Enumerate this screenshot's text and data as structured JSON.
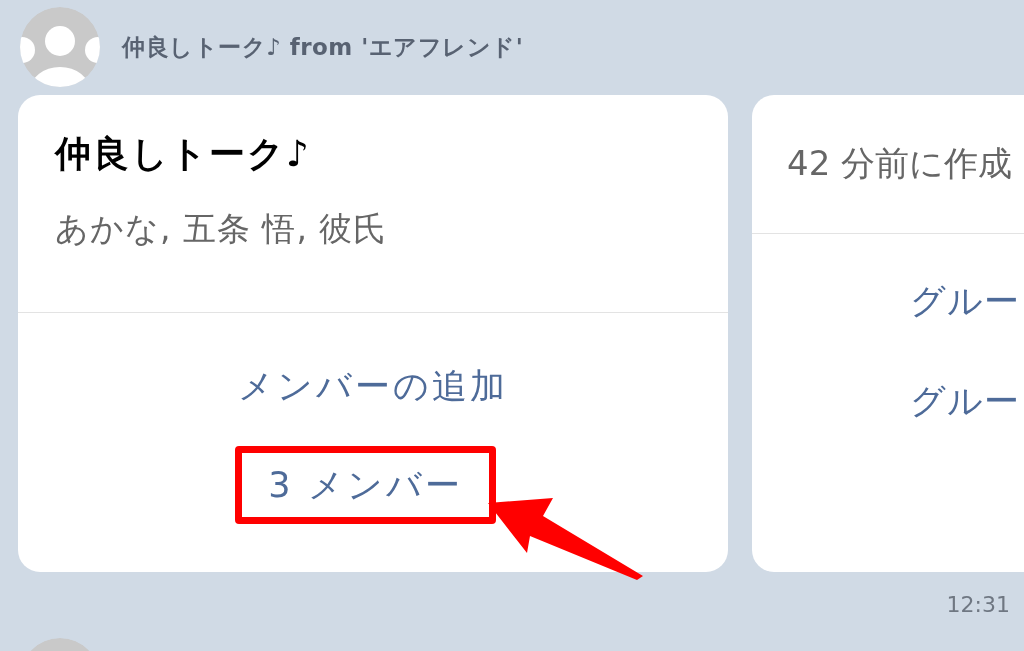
{
  "messages": [
    {
      "sender": "仲良しトーク♪ from 'エアフレンド'",
      "cards": [
        {
          "kind": "group_info",
          "title": "仲良しトーク♪",
          "members": "あかな, 五条 悟, 彼氏",
          "links": [
            {
              "label": "メンバーの追加",
              "highlighted": false
            },
            {
              "label": "3 メンバー",
              "highlighted": true
            }
          ]
        },
        {
          "kind": "created_info",
          "subtitle": "42 分前に作成",
          "links": [
            {
              "label": "グルー",
              "highlighted": false
            },
            {
              "label": "グルー",
              "highlighted": false
            }
          ]
        }
      ],
      "time": "12:31"
    }
  ]
}
